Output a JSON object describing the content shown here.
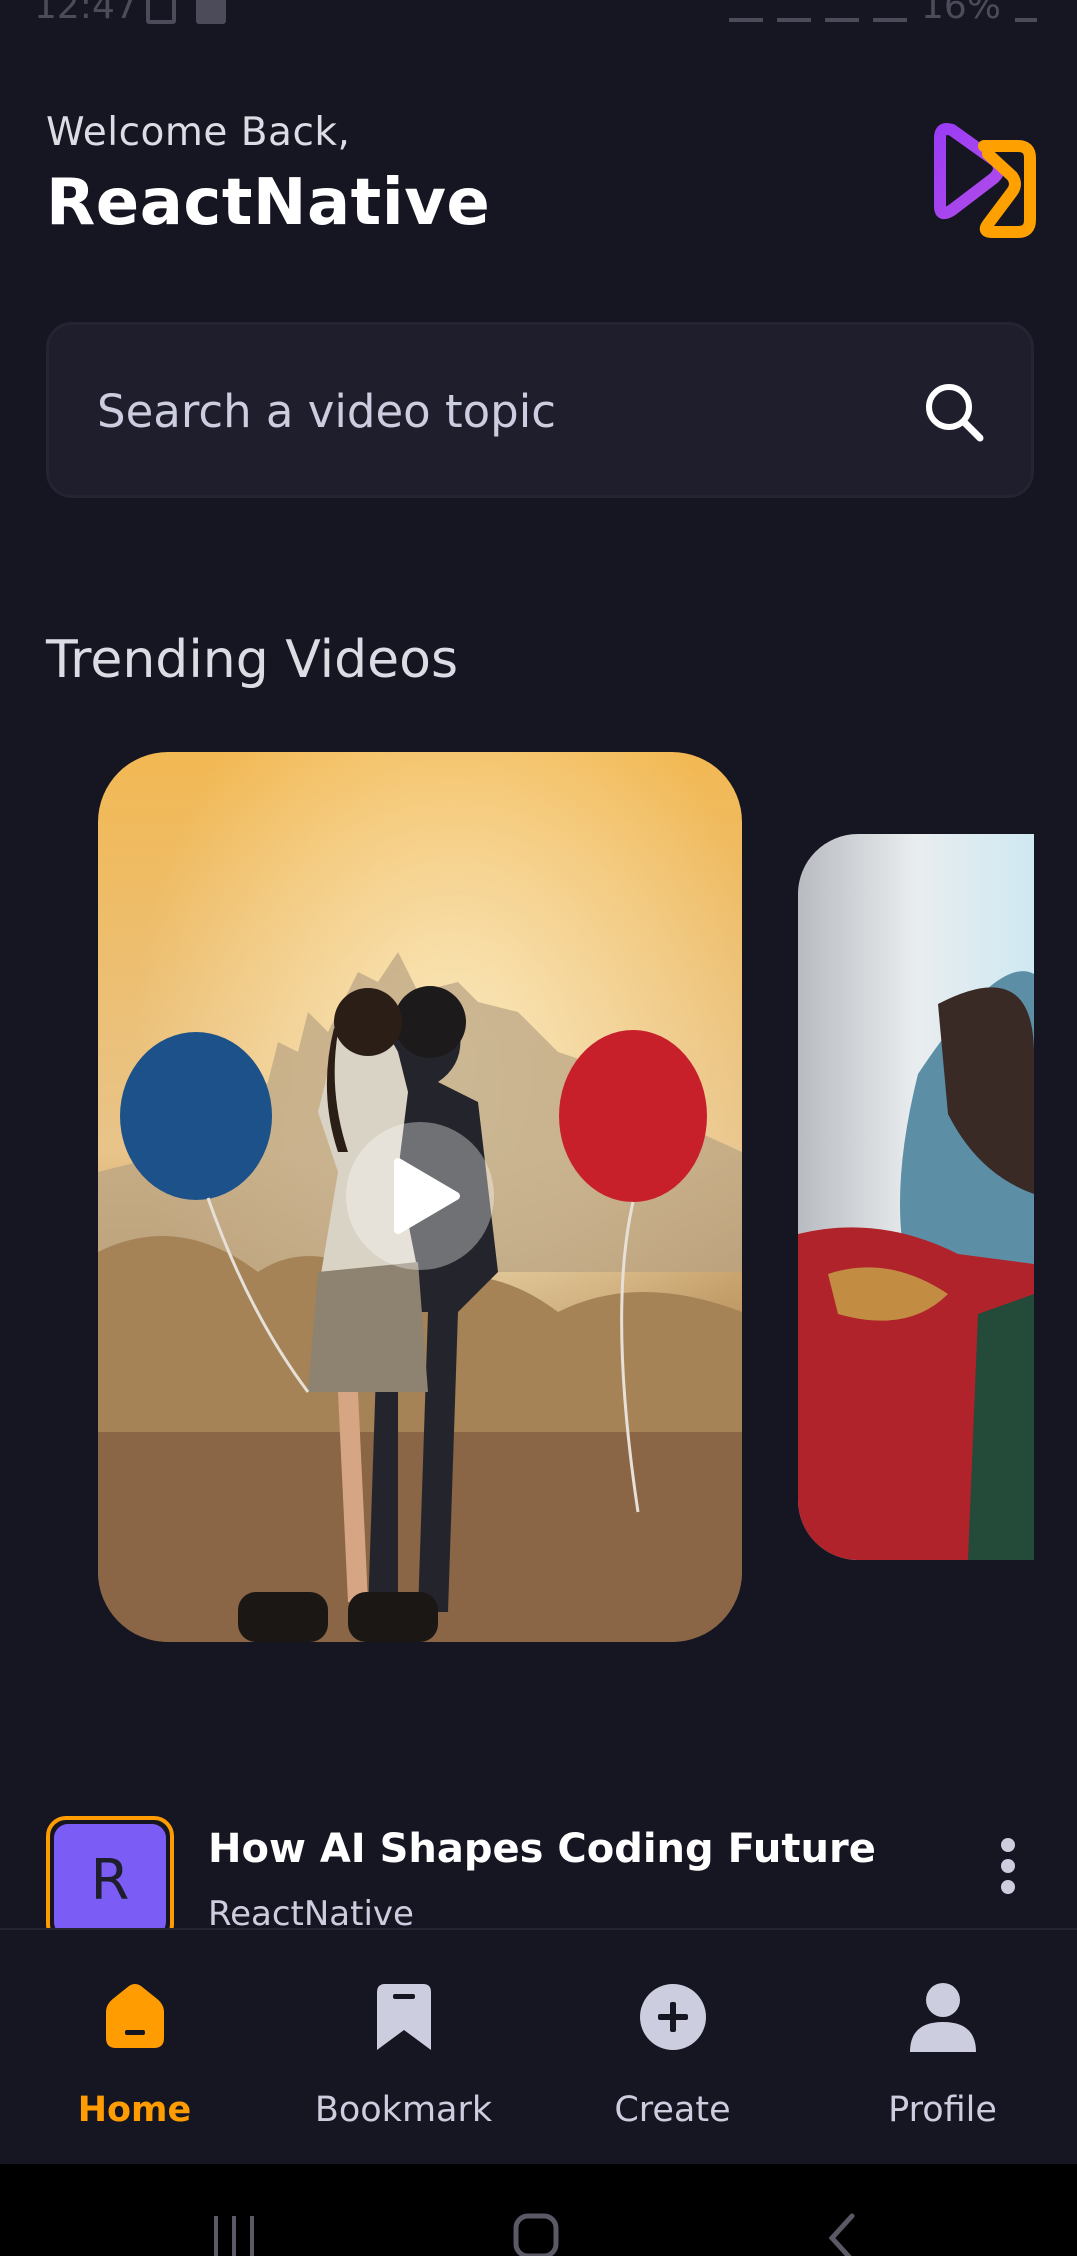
{
  "status_bar": {
    "time": "12:47",
    "battery": "16%"
  },
  "header": {
    "welcome": "Welcome Back,",
    "username": "ReactNative"
  },
  "search": {
    "placeholder": "Search a video topic"
  },
  "trending": {
    "title": "Trending Videos"
  },
  "video": {
    "avatar_letter": "R",
    "title": "How AI Shapes Coding Future",
    "creator": "ReactNative"
  },
  "tabs": [
    {
      "label": "Home",
      "icon": "home-icon",
      "active": true
    },
    {
      "label": "Bookmark",
      "icon": "bookmark-icon",
      "active": false
    },
    {
      "label": "Create",
      "icon": "plus-icon",
      "active": false
    },
    {
      "label": "Profile",
      "icon": "profile-icon",
      "active": false
    }
  ],
  "colors": {
    "background": "#161622",
    "accent": "#ff9c01",
    "avatar": "#7b5cf5",
    "input": "#1e1e2d"
  }
}
